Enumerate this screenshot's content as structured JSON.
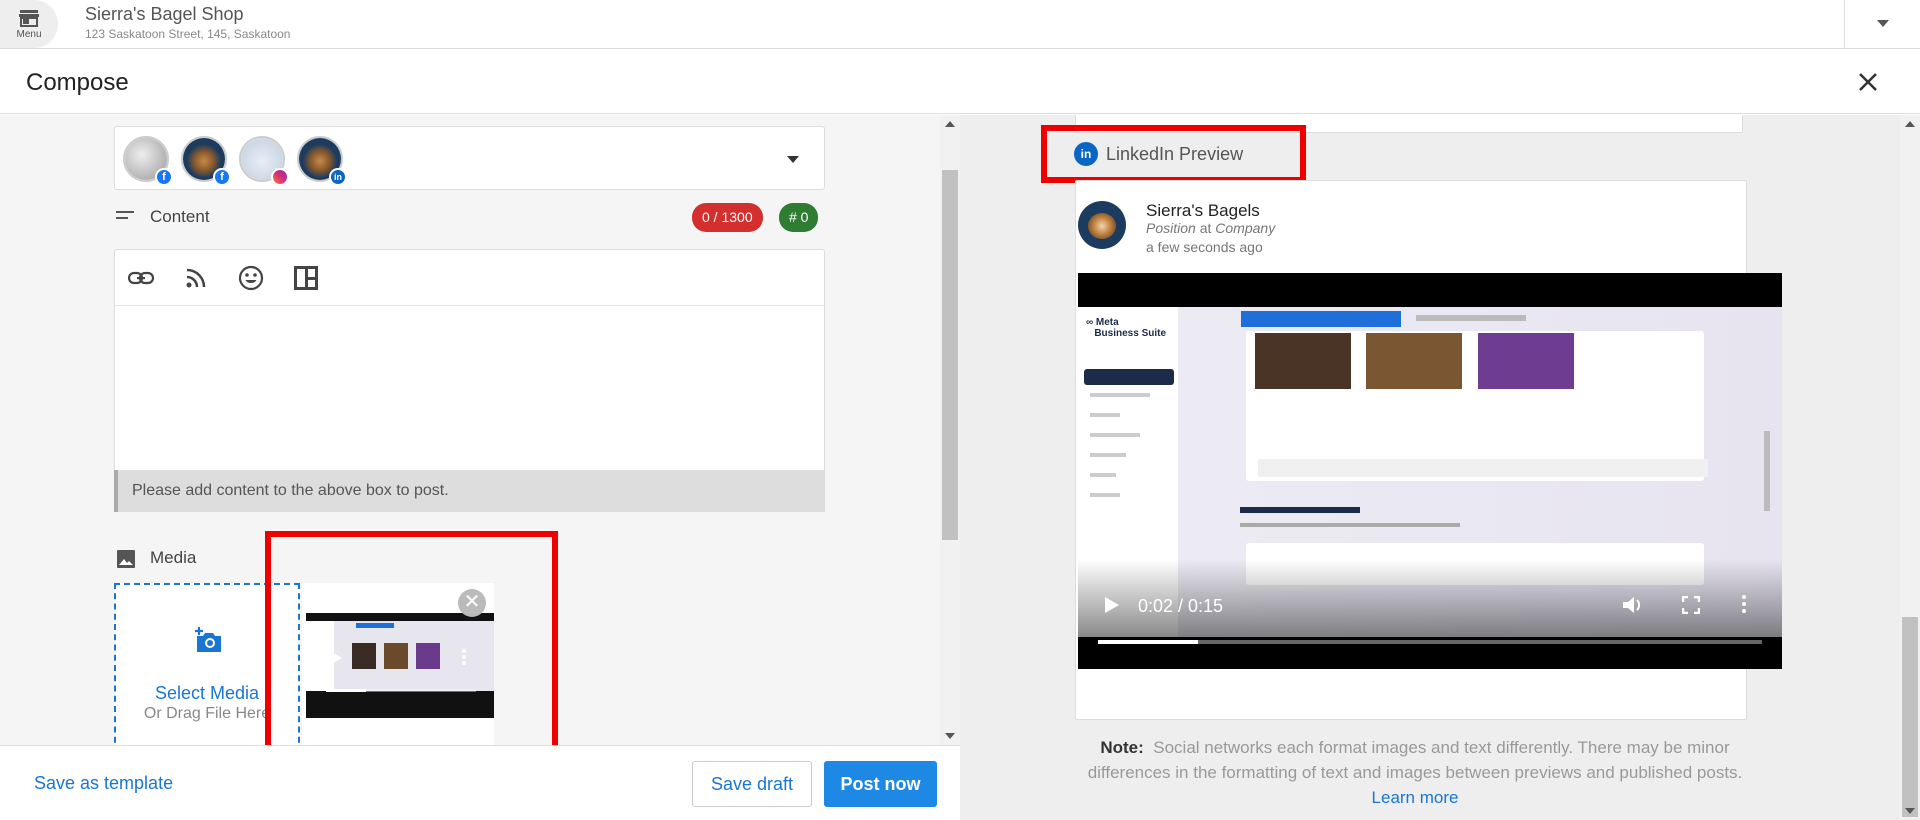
{
  "topbar": {
    "menu_label": "Menu",
    "business_name": "Sierra's Bagel Shop",
    "business_address": "123 Saskatoon Street, 145, Saskatoon"
  },
  "compose": {
    "title": "Compose"
  },
  "accounts": [
    {
      "network": "facebook",
      "badge": "f"
    },
    {
      "network": "facebook",
      "badge": "f"
    },
    {
      "network": "instagram",
      "badge": ""
    },
    {
      "network": "linkedin",
      "badge": "in"
    }
  ],
  "content": {
    "label": "Content",
    "char_count": "0 / 1300",
    "hashtag_count": "# 0",
    "warning": "Please add content to the above box to post."
  },
  "media": {
    "label": "Media",
    "select_title": "Select Media",
    "select_sub": "Or Drag File Here",
    "remove_symbol": "✕"
  },
  "footer": {
    "save_template": "Save as template",
    "save_draft": "Save draft",
    "post_now": "Post now"
  },
  "preview": {
    "label": "LinkedIn Preview",
    "li_logo": "in",
    "name": "Sierra's Bagels",
    "position_word": "Position",
    "at_word": "at",
    "company_word": "Company",
    "time": "a few seconds ago",
    "video_time": "0:02 / 0:15",
    "video_progress": 0.15,
    "note_label": "Note:",
    "note_text": "Social networks each format images and text differently. There may be minor differences in the formatting of text and images between previews and published posts.",
    "learn_more": "Learn more"
  },
  "colors": {
    "accent": "#1976d2",
    "highlight": "#ee0000",
    "danger_pill": "#d32f2f",
    "success_pill": "#2e7d32"
  },
  "icons": [
    "store-icon",
    "chevron-down-icon",
    "close-icon",
    "link-icon",
    "rss-icon",
    "emoji-icon",
    "layout-icon",
    "image-icon",
    "add-photo-icon",
    "play-icon",
    "volume-icon",
    "fullscreen-icon",
    "more-vert-icon",
    "linkedin-icon"
  ]
}
